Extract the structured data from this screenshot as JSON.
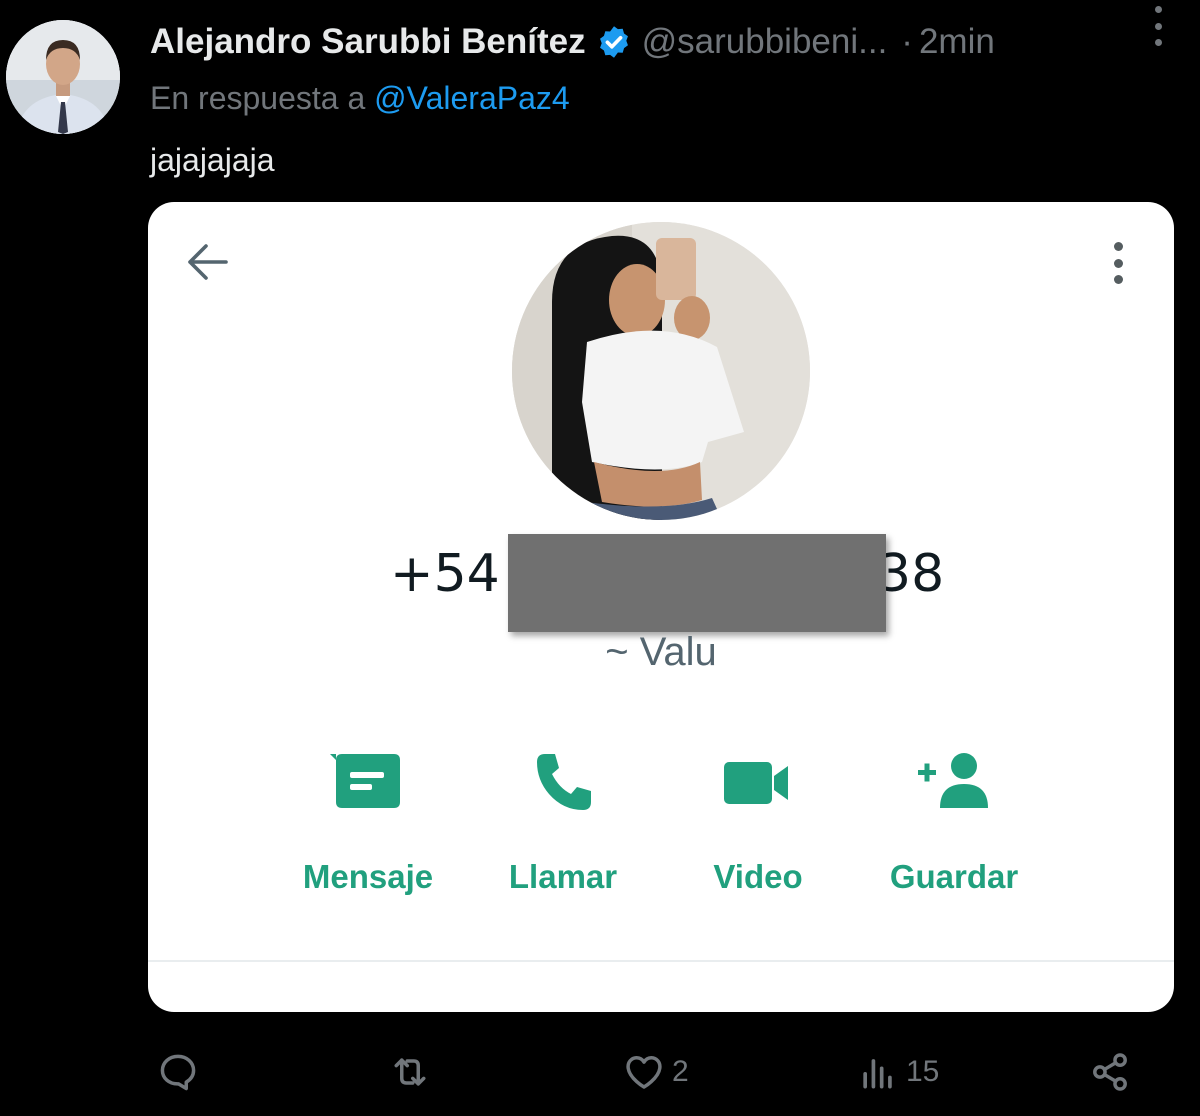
{
  "tweet": {
    "display_name": "Alejandro Sarubbi Benítez",
    "verified_icon": "verified-badge-icon",
    "handle": "@sarubbibeni...",
    "separator": "·",
    "time": "2min",
    "reply_prefix": "En respuesta a",
    "reply_mention": "@ValeraPaz4",
    "text": "jajajajaja"
  },
  "media": {
    "phone_prefix": "+54",
    "phone_suffix": "38",
    "contact_name": "~ Valu",
    "actions": [
      {
        "label": "Mensaje",
        "icon": "message-icon"
      },
      {
        "label": "Llamar",
        "icon": "phone-icon"
      },
      {
        "label": "Video",
        "icon": "video-icon"
      },
      {
        "label": "Guardar",
        "icon": "add-contact-icon"
      }
    ]
  },
  "actionbar": {
    "reply_count": "",
    "retweet_count": "",
    "like_count": "2",
    "views_count": "15"
  },
  "colors": {
    "background": "#000000",
    "text": "#e7e9ea",
    "muted": "#71767b",
    "link": "#1d9bf0",
    "whatsapp_green": "#21a07e"
  }
}
